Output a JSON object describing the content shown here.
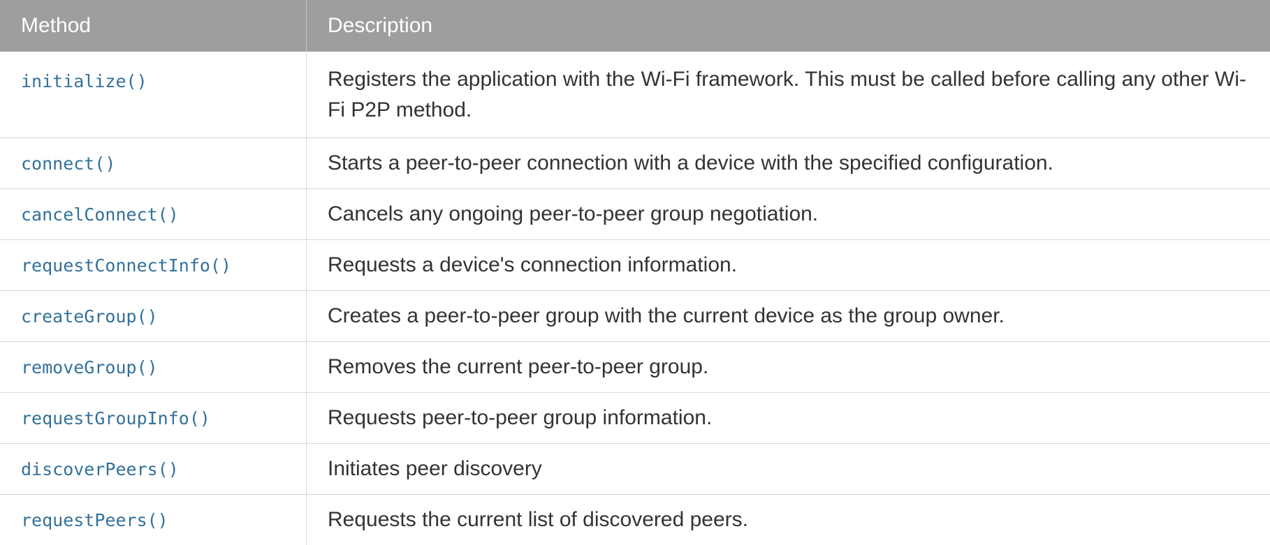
{
  "table": {
    "headers": [
      "Method",
      "Description"
    ],
    "rows": [
      {
        "method": "initialize()",
        "description": "Registers the application with the Wi-Fi framework. This must be called before calling any other Wi-Fi P2P method."
      },
      {
        "method": "connect()",
        "description": "Starts a peer-to-peer connection with a device with the specified configuration."
      },
      {
        "method": "cancelConnect()",
        "description": "Cancels any ongoing peer-to-peer group negotiation."
      },
      {
        "method": "requestConnectInfo()",
        "description": "Requests a device's connection information."
      },
      {
        "method": "createGroup()",
        "description": "Creates a peer-to-peer group with the current device as the group owner."
      },
      {
        "method": "removeGroup()",
        "description": "Removes the current peer-to-peer group."
      },
      {
        "method": "requestGroupInfo()",
        "description": "Requests peer-to-peer group information."
      },
      {
        "method": "discoverPeers()",
        "description": "Initiates peer discovery"
      },
      {
        "method": "requestPeers()",
        "description": "Requests the current list of discovered peers."
      }
    ]
  },
  "colors": {
    "header_bg": "#9e9e9e",
    "header_text": "#ffffff",
    "method_text": "#33719a",
    "description_text": "#333333",
    "border": "#d6d6d6"
  }
}
